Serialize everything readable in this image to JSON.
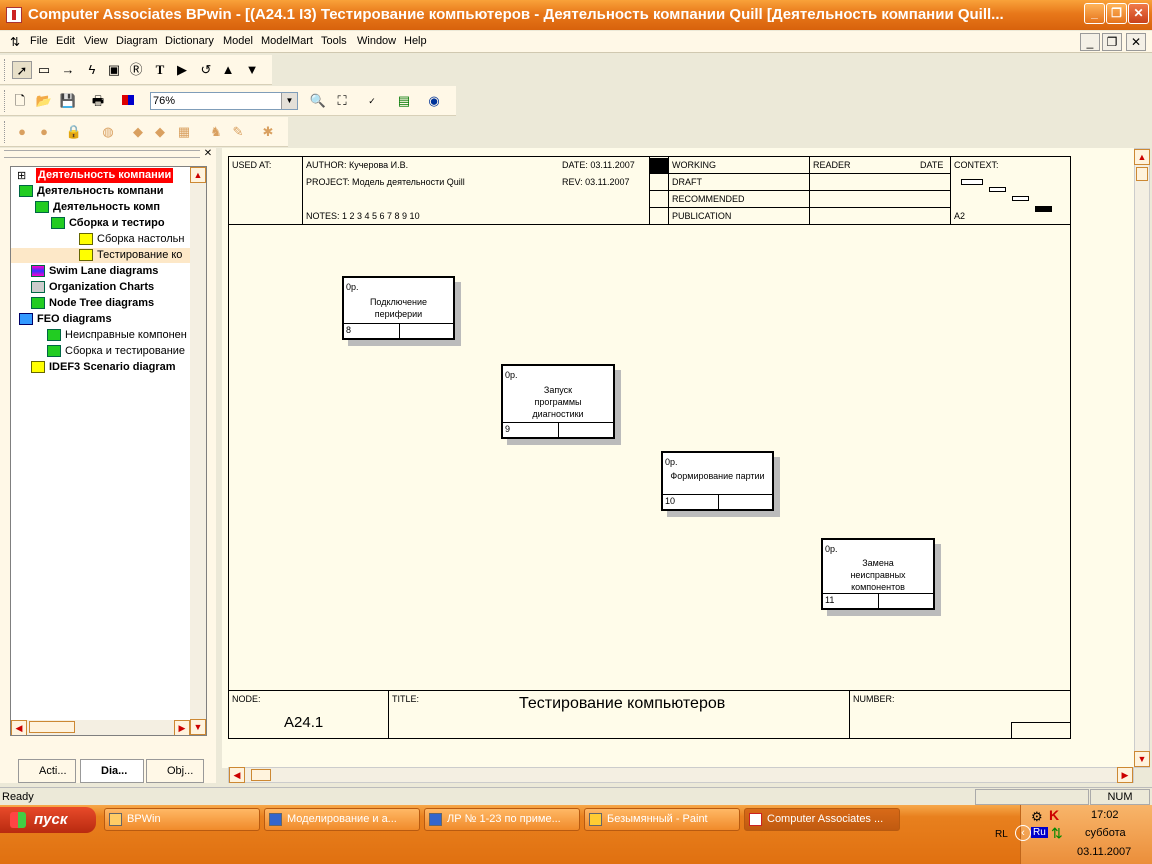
{
  "window": {
    "title": "Computer Associates BPwin - [(A24.1 I3) Тестирование компьютеров - Деятельность компании Quill  [Деятельность компании Quill..."
  },
  "menu": [
    "File",
    "Edit",
    "View",
    "Diagram",
    "Dictionary",
    "Model",
    "ModelMart",
    "Tools",
    "Window",
    "Help"
  ],
  "toolbar": {
    "zoom": "76%"
  },
  "tree": {
    "root": "Деятельность компании",
    "items": [
      "Деятельность компани",
      "Деятельность комп",
      "Сборка и тестиро",
      "Сборка настольн",
      "Тестирование ко",
      "Swim Lane diagrams",
      "Organization Charts",
      "Node Tree diagrams",
      "FEO diagrams",
      "Неисправные компонен",
      "Сборка и тестирование",
      "IDEF3 Scenario diagram"
    ]
  },
  "tabs": [
    "Acti...",
    "Dia...",
    "Obj..."
  ],
  "header": {
    "used_at": "USED AT:",
    "author": "AUTHOR:  Кучерова И.В.",
    "project": "PROJECT:  Модель деятельности Quill",
    "notes": "NOTES:  1  2  3  4  5  6  7  8  9  10",
    "date": "DATE: 03.11.2007",
    "rev": "REV:    03.11.2007",
    "working": "WORKING",
    "draft": "DRAFT",
    "recommended": "RECOMMENDED",
    "publication": "PUBLICATION",
    "reader": "READER",
    "date2": "DATE",
    "context": "CONTEXT:",
    "a2": "A2"
  },
  "boxes": [
    {
      "op": "0р.",
      "label": "Подключение периферии",
      "num": "8"
    },
    {
      "op": "0р.",
      "label": "Запуск программы диагностики",
      "num": "9"
    },
    {
      "op": "0р.",
      "label": "Формирование партии",
      "num": "10"
    },
    {
      "op": "0р.",
      "label": "Замена неисправных компонентов",
      "num": "11"
    }
  ],
  "footer": {
    "node_label": "NODE:",
    "node": "A24.1",
    "title_label": "TITLE:",
    "title": "Тестирование компьютеров",
    "number_label": "NUMBER:"
  },
  "status": {
    "text": "Ready",
    "num": "NUM"
  },
  "taskbar": {
    "start": "пуск",
    "tasks": [
      "BPWin",
      "Моделирование и а...",
      "ЛР № 1-23 по приме...",
      "Безымянный - Paint",
      "Computer Associates ..."
    ],
    "clock": "17:02",
    "day": "суббота",
    "date": "03.11.2007",
    "lang": "Ru",
    "rl": "RL"
  }
}
